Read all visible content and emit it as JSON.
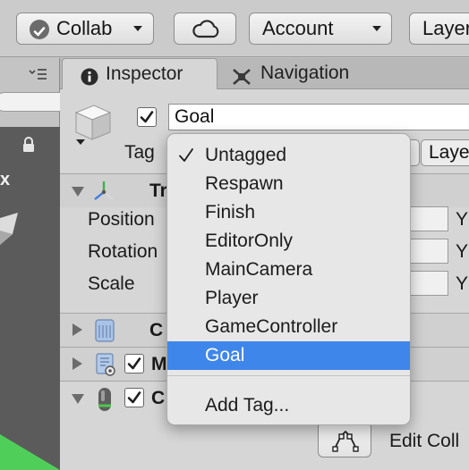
{
  "toolbar": {
    "collab_label": "Collab",
    "account_label": "Account",
    "layers_label": "Layer"
  },
  "tabs": [
    {
      "label": "Inspector",
      "active": true
    },
    {
      "label": "Navigation",
      "active": false
    }
  ],
  "left_panel": {
    "label_fragment": "x"
  },
  "inspector": {
    "object_name": "Goal",
    "active_checked": true,
    "tag_label": "Tag",
    "layer_label": "Laye",
    "transform": {
      "title_fragment": "Tr",
      "position_label": "Position",
      "rotation_label": "Rotation",
      "scale_label": "Scale",
      "axis_label": "Y"
    },
    "components": [
      {
        "title_fragment": "C"
      },
      {
        "title_fragment": "M"
      },
      {
        "title_fragment": "C"
      }
    ],
    "edit_collider_label": "Edit Coll"
  },
  "tag_dropdown": {
    "items": [
      "Untagged",
      "Respawn",
      "Finish",
      "EditorOnly",
      "MainCamera",
      "Player",
      "GameController",
      "Goal"
    ],
    "checked_item": "Untagged",
    "highlighted_item": "Goal",
    "add_tag_label": "Add Tag..."
  },
  "colors": {
    "selection": "#3f86ea",
    "panel": "#d6d6d6",
    "toolbar": "#cbcbcb",
    "scene_bg": "#5b5b5b",
    "scene_green": "#4fcf5a"
  },
  "icons": [
    "collab-check-icon",
    "cloud-icon",
    "panel-menu-icon",
    "info-icon",
    "navigation-icon",
    "gameobject-cube-icon",
    "lock-icon",
    "transform-axes-icon",
    "script-icon",
    "mesh-renderer-icon",
    "capsule-collider-icon",
    "edit-collider-icon",
    "checkmark-icon"
  ]
}
